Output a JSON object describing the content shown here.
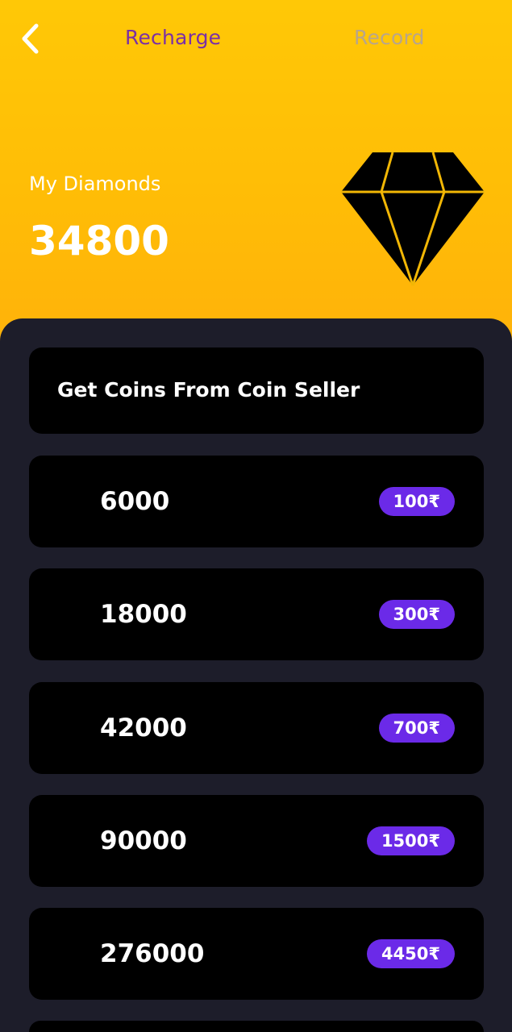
{
  "header": {
    "tabs": [
      {
        "label": "Recharge",
        "active": true
      },
      {
        "label": "Record",
        "active": false
      }
    ]
  },
  "balance": {
    "label": "My Diamonds",
    "value": "34800"
  },
  "seller": {
    "label": "Get Coins From Coin Seller"
  },
  "packages": [
    {
      "amount": "6000",
      "price": "100₹"
    },
    {
      "amount": "18000",
      "price": "300₹"
    },
    {
      "amount": "42000",
      "price": "700₹"
    },
    {
      "amount": "90000",
      "price": "1500₹"
    },
    {
      "amount": "276000",
      "price": "4450₹"
    }
  ],
  "colors": {
    "header_background": "#FFBD06",
    "tab_active": "#7B2FA6",
    "tab_inactive": "#B8A58C",
    "panel_background": "#1D1D2A",
    "card_background": "#000000",
    "price_badge": "#6B2AE8",
    "diamond_outline": "#F2B705"
  },
  "icons": {
    "back": "chevron-left-icon",
    "balance": "diamond-icon"
  }
}
